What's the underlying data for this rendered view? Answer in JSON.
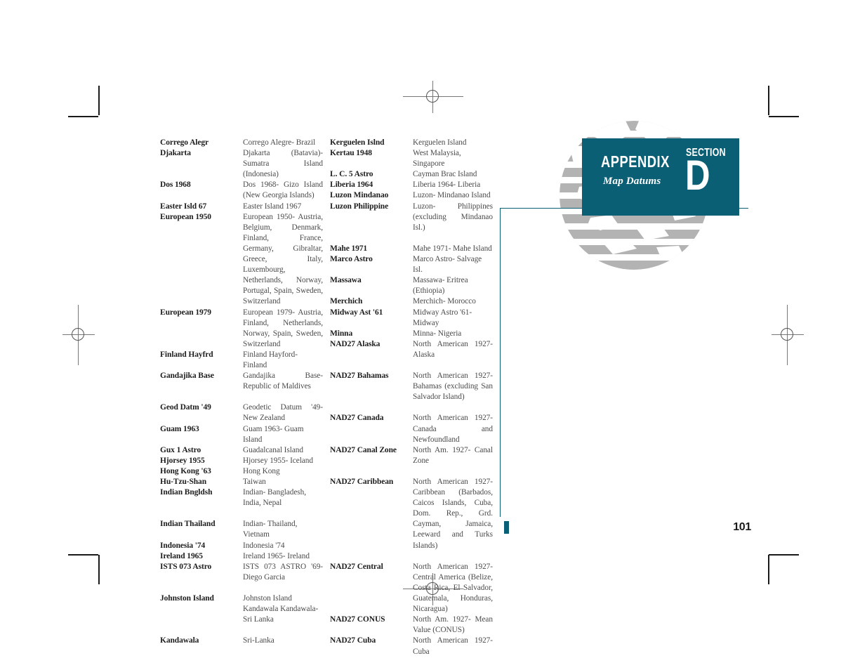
{
  "header": {
    "appendix_label": "APPENDIX",
    "subtitle": "Map Datums",
    "section_label": "SECTION",
    "section_letter": "D",
    "badge_color": "#0a5f75",
    "globe_color": "#b3b3b3"
  },
  "footer": {
    "page_number": "101",
    "bar_color": "#0a5f75"
  },
  "columns": [
    {
      "id": "column-left",
      "rows": [
        {
          "name": "Corrego Alegr",
          "desc": "Corrego Alegre- Brazil",
          "justify": false,
          "gap": false
        },
        {
          "name": "Djakarta",
          "desc": "Djakarta (Batavia)- Sumatra Island (Indonesia)",
          "justify": true,
          "gap": false
        },
        {
          "name": "Dos 1968",
          "desc": "Dos 1968- Gizo Island (New Georgia Islands)",
          "justify": true,
          "gap": false
        },
        {
          "name": "Easter Isld 67",
          "desc": "Easter Island 1967",
          "justify": false,
          "gap": false
        },
        {
          "name": "European 1950",
          "desc": "European 1950- Austria, Belgium, Denmark, Finland, France, Germany, Gibraltar, Greece, Italy, Luxembourg, Netherlands, Norway, Portugal, Spain, Sweden, Switzerland",
          "justify": true,
          "gap": false
        },
        {
          "name": "European 1979",
          "desc": "European 1979- Austria, Finland, Netherlands, Norway, Spain, Sweden, Switzerland",
          "justify": true,
          "gap": false
        },
        {
          "name": "Finland Hayfrd",
          "desc": "Finland Hayford- Finland",
          "justify": false,
          "gap": false
        },
        {
          "name": "Gandajika Base",
          "desc": "Gandajika Base- Republic of Maldives",
          "justify": true,
          "gap": false
        },
        {
          "name": "Geod Datm '49",
          "desc": "Geodetic Datum '49- New Zealand",
          "justify": true,
          "gap": true
        },
        {
          "name": "Guam 1963",
          "desc": "Guam 1963- Guam Island",
          "justify": false,
          "gap": false
        },
        {
          "name": "Gux 1 Astro",
          "desc": "Guadalcanal Island",
          "justify": false,
          "gap": false
        },
        {
          "name": "Hjorsey 1955",
          "desc": "Hjorsey 1955- Iceland",
          "justify": false,
          "gap": false
        },
        {
          "name": "Hong Kong '63",
          "desc": "Hong Kong",
          "justify": false,
          "gap": false
        },
        {
          "name": "Hu-Tzu-Shan",
          "desc": "Taiwan",
          "justify": false,
          "gap": false
        },
        {
          "name": "Indian Bngldsh",
          "desc": "Indian- Bangladesh, India, Nepal",
          "justify": false,
          "gap": false
        },
        {
          "name": "Indian Thailand",
          "desc": "Indian- Thailand, Vietnam",
          "justify": false,
          "gap": true
        },
        {
          "name": "Indonesia '74",
          "desc": "Indonesia '74",
          "justify": false,
          "gap": false
        },
        {
          "name": "Ireland 1965",
          "desc": "Ireland 1965- Ireland",
          "justify": false,
          "gap": false
        },
        {
          "name": "ISTS 073 Astro",
          "desc": "ISTS 073 ASTRO '69- Diego Garcia",
          "justify": true,
          "gap": false
        },
        {
          "name": "Johnston Island",
          "desc": "Johnston Island Kandawala Kandawala- Sri Lanka",
          "justify": false,
          "gap": true
        },
        {
          "name": "Kandawala",
          "desc": "Sri-Lanka",
          "justify": false,
          "gap": true
        }
      ]
    },
    {
      "id": "column-right",
      "rows": [
        {
          "name": "Kerguelen Islnd",
          "desc": "Kerguelen Island",
          "justify": false,
          "gap": false
        },
        {
          "name": "Kertau 1948",
          "desc": "West Malaysia, Singapore",
          "justify": false,
          "gap": false
        },
        {
          "name": "L. C. 5 Astro",
          "desc": "Cayman Brac Island",
          "justify": false,
          "gap": false
        },
        {
          "name": "Liberia 1964",
          "desc": "Liberia 1964- Liberia",
          "justify": false,
          "gap": false
        },
        {
          "name": "Luzon Mindanao",
          "desc": "Luzon- Mindanao Island",
          "justify": false,
          "gap": false
        },
        {
          "name": "Luzon Philippine",
          "desc": "Luzon- Philippines (excluding Mindanao Isl.)",
          "justify": true,
          "gap": false
        },
        {
          "name": "Mahe 1971",
          "desc": "Mahe 1971- Mahe Island",
          "justify": false,
          "gap": true
        },
        {
          "name": "Marco Astro",
          "desc": "Marco Astro- Salvage Isl.",
          "justify": false,
          "gap": false
        },
        {
          "name": "Massawa",
          "desc": "Massawa- Eritrea (Ethiopia)",
          "justify": false,
          "gap": false
        },
        {
          "name": "Merchich",
          "desc": "Merchich- Morocco",
          "justify": false,
          "gap": false
        },
        {
          "name": "Midway Ast '61",
          "desc": "Midway Astro '61- Midway",
          "justify": false,
          "gap": false
        },
        {
          "name": "Minna",
          "desc": "Minna- Nigeria",
          "justify": false,
          "gap": false
        },
        {
          "name": "NAD27 Alaska",
          "desc": "North American 1927- Alaska",
          "justify": true,
          "gap": false
        },
        {
          "name": "NAD27 Bahamas",
          "desc": "North American 1927- Bahamas (excluding San Salvador Island)",
          "justify": true,
          "gap": true
        },
        {
          "name": "NAD27 Canada",
          "desc": "North American 1927- Canada and Newfoundland",
          "justify": true,
          "gap": true
        },
        {
          "name": "NAD27 Canal Zone",
          "desc": "North Am. 1927- Canal Zone",
          "justify": true,
          "gap": false
        },
        {
          "name": "NAD27 Caribbean",
          "desc": "North American 1927- Caribbean (Barbados, Caicos Islands, Cuba, Dom. Rep., Grd. Cayman, Jamaica, Leeward and Turks Islands)",
          "justify": true,
          "gap": true
        },
        {
          "name": "NAD27 Central",
          "desc": "North American 1927- Central America (Belize, Costa Rica, El Salvador, Guatemala, Honduras, Nicaragua)",
          "justify": true,
          "gap": true
        },
        {
          "name": "NAD27 CONUS",
          "desc": "North Am. 1927- Mean Value (CONUS)",
          "justify": true,
          "gap": false
        },
        {
          "name": "NAD27 Cuba",
          "desc": "North American 1927- Cuba",
          "justify": true,
          "gap": false
        }
      ]
    }
  ]
}
